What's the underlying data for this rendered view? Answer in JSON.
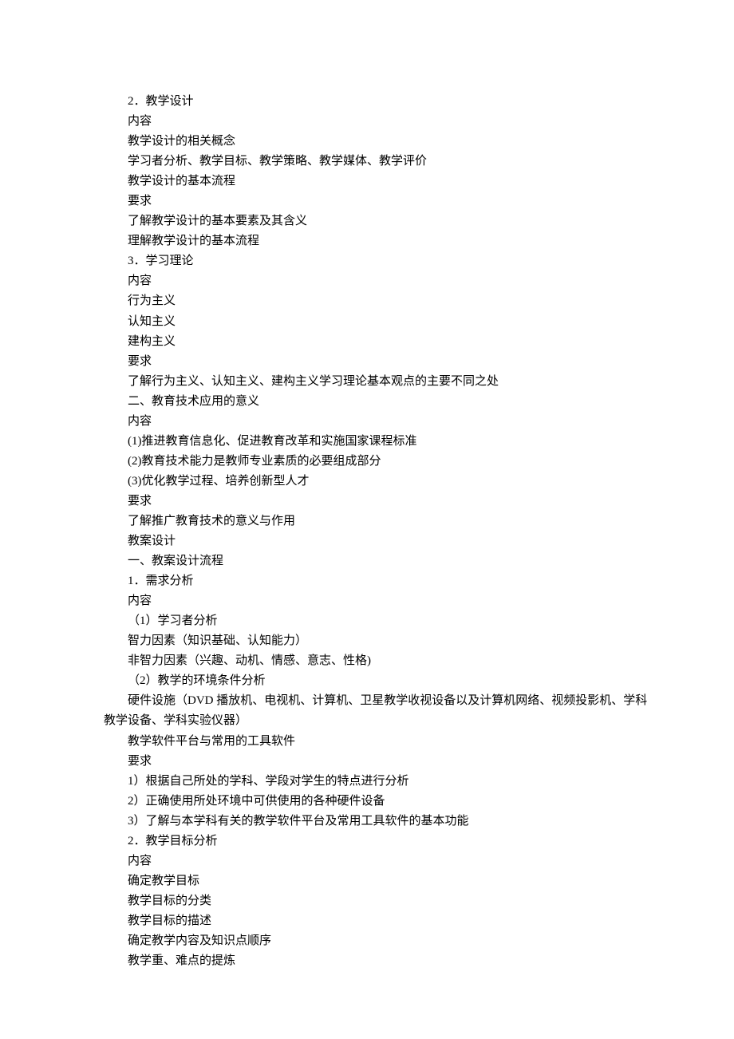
{
  "lines": [
    "2．教学设计",
    "内容",
    "教学设计的相关概念",
    "学习者分析、教学目标、教学策略、教学媒体、教学评价",
    "教学设计的基本流程",
    "要求",
    "了解教学设计的基本要素及其含义",
    "理解教学设计的基本流程",
    "3．学习理论",
    "内容",
    "行为主义",
    "认知主义",
    "建构主义",
    "要求",
    "了解行为主义、认知主义、建构主义学习理论基本观点的主要不同之处",
    "二、教育技术应用的意义",
    "内容",
    "(1)推进教育信息化、促进教育改革和实施国家课程标准",
    "(2)教育技术能力是教师专业素质的必要组成部分",
    "(3)优化教学过程、培养创新型人才",
    "要求",
    "了解推广教育技术的意义与作用",
    "教案设计",
    "一、教案设计流程",
    "1．需求分析",
    "内容",
    "（1）学习者分析",
    "智力因素（知识基础、认知能力）",
    "非智力因素（兴趣、动机、情感、意志、性格)",
    "（2）教学的环境条件分析",
    "硬件设施（DVD 播放机、电视机、计算机、卫星教学收视设备以及计算机网络、视频投影机、学科教学设备、学科实验仪器）",
    "教学软件平台与常用的工具软件",
    "要求",
    "1）根据自己所处的学科、学段对学生的特点进行分析",
    "2）正确使用所处环境中可供使用的各种硬件设备",
    "3）了解与本学科有关的教学软件平台及常用工具软件的基本功能",
    "2．教学目标分析",
    "内容",
    "确定教学目标",
    "教学目标的分类",
    "教学目标的描述",
    "确定教学内容及知识点顺序",
    "教学重、难点的提炼"
  ],
  "special_indent_indices": [
    30
  ]
}
